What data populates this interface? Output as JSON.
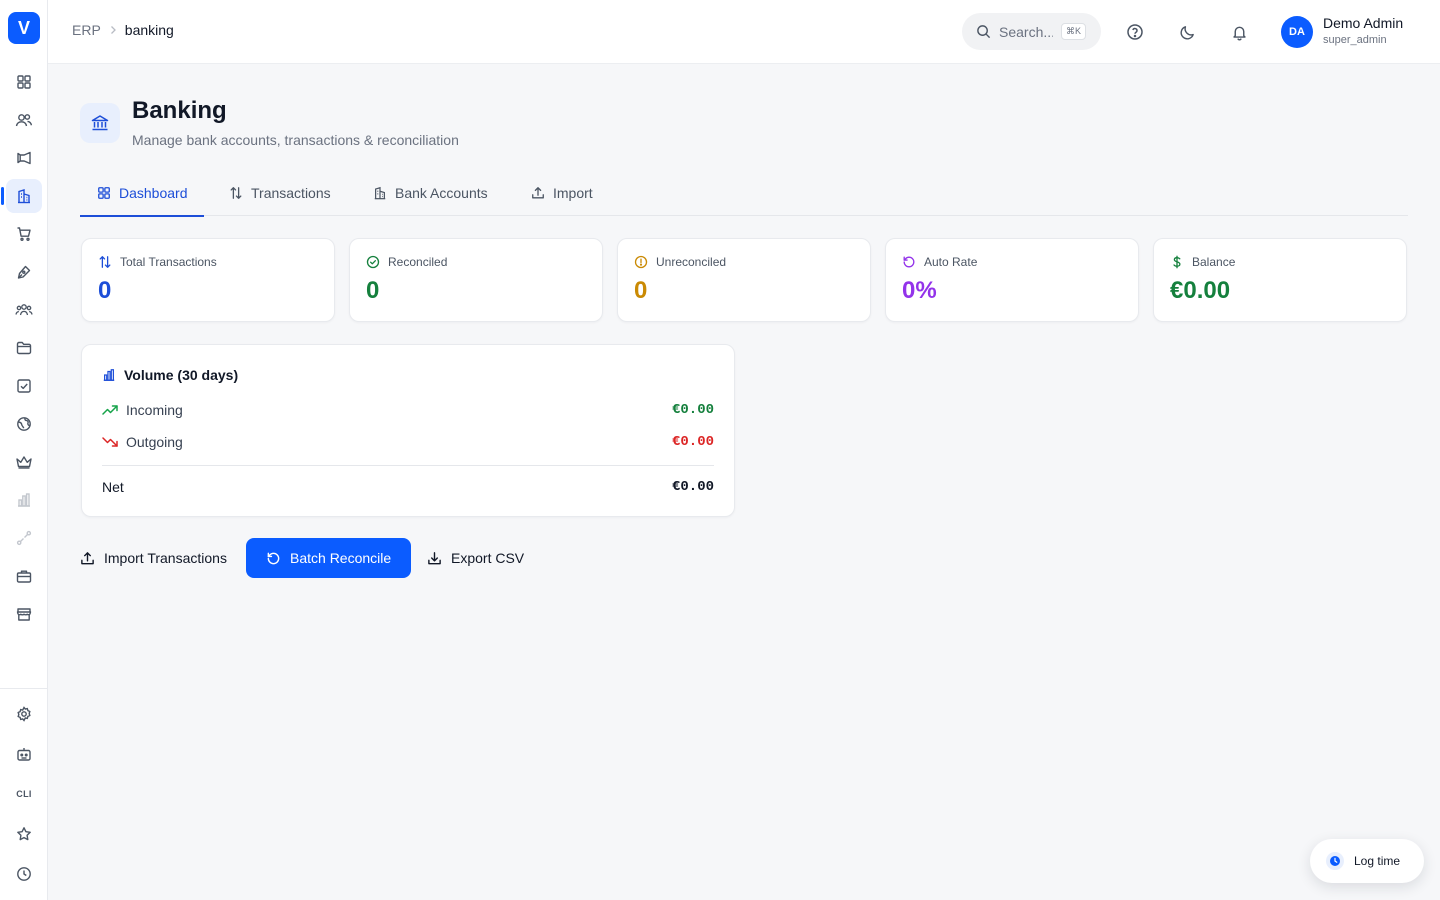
{
  "app": {
    "logo_letter": "V"
  },
  "breadcrumb": {
    "root": "ERP",
    "current": "banking"
  },
  "search": {
    "placeholder": "Search...",
    "shortcut": "⌘K"
  },
  "user": {
    "initials": "DA",
    "name": "Demo Admin",
    "role": "super_admin"
  },
  "sidebar": {
    "items": [
      {
        "name": "dashboard",
        "icon": "grid-icon"
      },
      {
        "name": "contacts",
        "icon": "users-icon"
      },
      {
        "name": "marketing",
        "icon": "megaphone-icon"
      },
      {
        "name": "banking",
        "icon": "bank-icon",
        "active": true
      },
      {
        "name": "sales",
        "icon": "cart-icon"
      },
      {
        "name": "design",
        "icon": "pen-icon"
      },
      {
        "name": "team",
        "icon": "team-icon"
      },
      {
        "name": "files",
        "icon": "folder-icon"
      },
      {
        "name": "tasks",
        "icon": "check-square-icon"
      },
      {
        "name": "web",
        "icon": "globe-icon"
      },
      {
        "name": "premium",
        "icon": "crown-icon"
      },
      {
        "name": "reports",
        "icon": "bar-chart-icon",
        "faded": true
      },
      {
        "name": "workflow",
        "icon": "route-icon",
        "faded": true
      },
      {
        "name": "tools",
        "icon": "toolbox-icon"
      },
      {
        "name": "store",
        "icon": "store-icon"
      }
    ],
    "bottom": [
      {
        "name": "settings",
        "icon": "gear-icon"
      },
      {
        "name": "bot",
        "icon": "robot-icon"
      },
      {
        "name": "cli",
        "label": "CLI"
      },
      {
        "name": "favorites",
        "icon": "star-icon"
      },
      {
        "name": "history",
        "icon": "clock-icon"
      }
    ]
  },
  "page": {
    "title": "Banking",
    "subtitle": "Manage bank accounts, transactions & reconciliation"
  },
  "tabs": [
    {
      "label": "Dashboard",
      "icon": "grid-icon",
      "active": true
    },
    {
      "label": "Transactions",
      "icon": "arrows-updown-icon"
    },
    {
      "label": "Bank Accounts",
      "icon": "bank-building-icon"
    },
    {
      "label": "Import",
      "icon": "upload-icon"
    }
  ],
  "stats": [
    {
      "label": "Total Transactions",
      "value": "0",
      "color": "#1d4ed8",
      "icon": "arrows-updown-icon"
    },
    {
      "label": "Reconciled",
      "value": "0",
      "color": "#15803d",
      "icon": "check-circle-icon"
    },
    {
      "label": "Unreconciled",
      "value": "0",
      "color": "#ca8a04",
      "icon": "alert-circle-icon"
    },
    {
      "label": "Auto Rate",
      "value": "0%",
      "color": "#9333ea",
      "icon": "rotate-icon"
    },
    {
      "label": "Balance",
      "value": "€0.00",
      "color": "#15803d",
      "icon": "dollar-icon"
    }
  ],
  "volume": {
    "title": "Volume (30 days)",
    "incoming": {
      "label": "Incoming",
      "value": "€0.00",
      "color": "#15803d"
    },
    "outgoing": {
      "label": "Outgoing",
      "value": "€0.00",
      "color": "#dc2626"
    },
    "net": {
      "label": "Net",
      "value": "€0.00",
      "color": "#111827"
    }
  },
  "actions": {
    "import": "Import Transactions",
    "batch": "Batch Reconcile",
    "export": "Export CSV"
  },
  "log_time": {
    "label": "Log time"
  }
}
